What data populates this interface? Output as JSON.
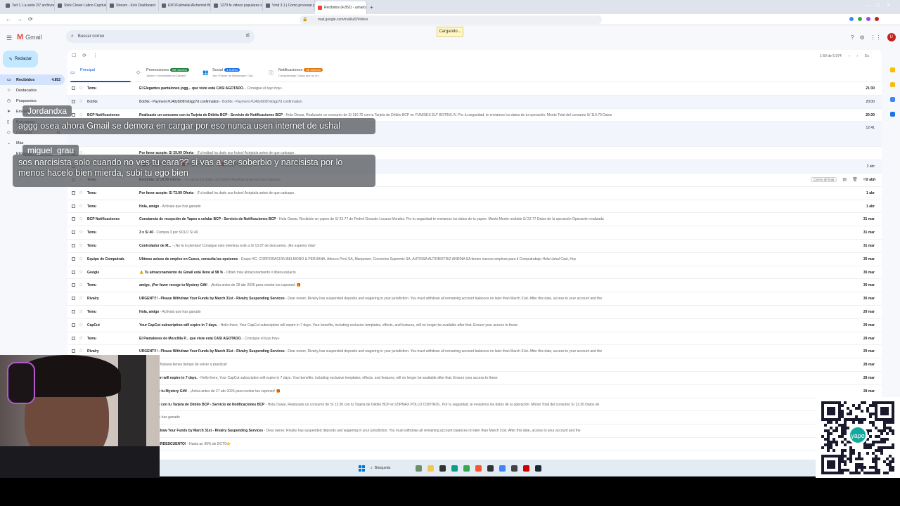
{
  "browser": {
    "tabs": [
      {
        "title": "Ted 1. La serie 2/7 archivos - HeliCrest"
      },
      {
        "title": "Stick Clover Latino Capítulo 160 - Yu"
      },
      {
        "title": "Stream - Kick Dashboard"
      },
      {
        "title": "ENT/Fullmetal Alchemist Brotherhood"
      },
      {
        "title": "1279 fe videos populares seleccion"
      },
      {
        "title": "Vmd 3.1 | Como procesar para pro"
      },
      {
        "title": "Recibidos (4.852) - ushalcast@g",
        "active": true
      }
    ],
    "new_tab": "+",
    "url": "mail.google.com/mail/u/0/#inbox",
    "loading_text": "Cargando..."
  },
  "gmail": {
    "app_name": "Gmail",
    "search_placeholder": "Buscar correo",
    "avatar_letter": "U",
    "compose_label": "Redactar",
    "sidebar": [
      {
        "label": "Recibidos",
        "count": "4.852",
        "icon": "inbox-icon",
        "active": true
      },
      {
        "label": "Destacados",
        "count": "",
        "icon": "star-icon"
      },
      {
        "label": "Pospuestos",
        "count": "",
        "icon": "clock-icon"
      },
      {
        "label": "Enviados",
        "count": "",
        "icon": "send-icon"
      },
      {
        "label": "Borradores",
        "count": "",
        "icon": "draft-icon"
      },
      {
        "label": "Compras",
        "count": "41",
        "icon": "tag-icon"
      },
      {
        "label": "Más",
        "count": "",
        "icon": "chevron-down-icon"
      },
      {
        "label": "Etiquetas",
        "count": "",
        "icon": ""
      }
    ],
    "pager": {
      "range": "1-50 de 5.074",
      "lang": "Es"
    },
    "category_tabs": [
      {
        "label": "Principal",
        "badge": "",
        "sub": "",
        "icon": "inbox-icon",
        "active": true
      },
      {
        "label": "Promociones",
        "badge": "50 nuevos",
        "badge_color": "#188038",
        "sub": "Jabeer • Novedades en Disney+",
        "icon": "tag-icon"
      },
      {
        "label": "Social",
        "badge": "1 nuevo",
        "badge_color": "#1a73e8",
        "sub": "Jee • Roses de Messenger: Cali...",
        "icon": "people-icon"
      },
      {
        "label": "Notificaciones",
        "badge": "35 nuevos",
        "badge_color": "#e37400",
        "sub": "Computrabajo: Datos que no en...",
        "icon": "info-icon"
      }
    ],
    "hover_pill": "Correo de hoja",
    "attachments": [
      {
        "name": "MVI_1453.MOV"
      },
      {
        "name": "MVI_1447.MOV"
      },
      {
        "name": "MVI_1455.MOV"
      }
    ],
    "emails": [
      {
        "sender": "Temu",
        "subject": "El Elegantes pantalones jogg... que viste está CASI AGOTADO.",
        "snippet": " - Consigue el tuyo hoy»",
        "date": "21:30",
        "read": false
      },
      {
        "sender": "BotiNx",
        "subject": "BotiNx - Payment #U40yt9087ebigp7d confirmation",
        "snippet": " - BotiNx - Payment #U40yt9087ebigp7d confirmation",
        "date": "20:00",
        "read": true
      },
      {
        "sender": "BCP Notificaciones",
        "subject": "Realizaste un consumo con tu Tarjeta de Débito BCP - Servicio de Notificaciones BCP",
        "snippet": " - Hola Oswar, Realizaste un consumo de S/ 110.70 con tu Tarjeta de Débito BCP en FUNGIES EU* BOTINX.IV. Por tu seguridad, te enviamos los datos de tu operación. Monto Total del consumo S/ 110.70 Datos",
        "date": "20:30",
        "read": false
      },
      {
        "sender": "",
        "subject": "",
        "snippet": "15:39 Subject: tus videos To: <ushalcast@gmail.com> MVI_1430...",
        "date": "12:41",
        "read": true,
        "tall": true
      },
      {
        "sender": "",
        "subject": "Por favor acepte: S/ 29.99 Oferta",
        "snippet": " - ¡Tu lealtad ha dado sus frutos! Acéptala antes de que caduque.",
        "date": "",
        "read": false
      },
      {
        "sender": "",
        "subject": "",
        "snippet": "",
        "date": "2 abr",
        "read": true
      },
      {
        "sender": "Temu",
        "subject": "Recibida: S/ 29.99 Oferta",
        "snippet": " - ¡Tu apoyo ha dado sus frutos! Acéptala antes de que caduque.",
        "date": "2 abr",
        "read": false
      },
      {
        "sender": "Temu",
        "subject": "Por favor acepte: S/ 73.99 Oferta",
        "snippet": " - ¡Tu lealtad ha dado sus frutos! Acéptala antes de que caduque.",
        "date": "1 abr",
        "read": false
      },
      {
        "sender": "Temu",
        "subject": "Hola, amigo",
        "snippet": " - Actívala que has ganado",
        "date": "1 abr",
        "read": false
      },
      {
        "sender": "BCP Notificaciones",
        "subject": "Constancia de recepción de Yapeo a celular BCP - Servicio de Notificaciones BCP",
        "snippet": " - Hola Oswar, Recibiste un yapeo de S/ 22.77 de Pedrel Gonzalo Lucana Morales. Por tu seguridad te enviamos los datos de tu yapeo. Monto Monto recibido S/ 22.77 Datos de la operación Operación realizada",
        "date": "31 mar",
        "read": false
      },
      {
        "sender": "Temu",
        "subject": "3 x S/ 40",
        "snippet": " - Compra 3 por SOLO S/ 40",
        "date": "31 mar",
        "read": false
      },
      {
        "sender": "Temu",
        "subject": "Controlador de M...",
        "snippet": " - ¡No te lo pierdas! Consigue esto mientras esté a S/ 13.07 de descuento. ¡No esperes más!",
        "date": "31 mar",
        "read": false
      },
      {
        "sender": "Equipo de Computrab.",
        "subject": "Últimos avisos de empleo en Cusco, consulta las opciones",
        "snippet": " - Grupo HC, CORPORACIÓN BELMONO & PERUANA, Adecco Perú SA, Manpower, Concretos Supermix SA, AUTRISA AUTOMOTRIZ ANDINA SA tienen nuevos empleos para ti Computrabajo Hola Ushal Cast, Hoy",
        "date": "30 mar",
        "read": false
      },
      {
        "sender": "Google",
        "subject": "⚠️ Tu almacenamiento de Gmail está lleno al 98 %",
        "snippet": " - Obtén más almacenamiento o libera espacio",
        "date": "30 mar",
        "read": false
      },
      {
        "sender": "Temu",
        "subject": "amigo, ¡Por favor recoge tu Mystery Gift!",
        "snippet": " - ¡Actúa antes de 29 abr 2026 para revelar tus cupones! 🎁",
        "date": "30 mar",
        "read": false
      },
      {
        "sender": "Rivalry",
        "subject": "URGENT!!! - Please Withdraw Your Funds by March 31st - Rivalry Suspending Services",
        "snippet": " - Dear owner, Rivalry has suspended deposits and wagering in your jurisdiction. You must withdraw all remaining account balances no later than March 31st. After this date, access to your account and the",
        "date": "30 mar",
        "read": false
      },
      {
        "sender": "Temu",
        "subject": "Hola, amigo",
        "snippet": " - Actívala que has ganado",
        "date": "29 mar",
        "read": false
      },
      {
        "sender": "CapCut",
        "subject": "Your CapCut subscription will expire in 7 days.",
        "snippet": " - Hello there, Your CapCut subscription will expire in 7 days. Your benefits, including exclusive templates, effects, and features, will no longer be available after that. Ensure your access to these",
        "date": "29 mar",
        "read": false
      },
      {
        "sender": "Temu",
        "subject": "El Pantalones de Mezclilla P... que viste está CASI AGOTADO.",
        "snippet": " - Consigue el tuyo hoy»",
        "date": "29 mar",
        "read": false
      },
      {
        "sender": "Rivalry",
        "subject": "URGENT!!! - Please Withdraw Your Funds by March 31st - Rivalry Suspending Services",
        "snippet": " - Dear owner, Rivalry has suspended deposits and wagering in your jurisdiction. You must withdraw all remaining account balances no later than March 31st. After this date, access to your account and the",
        "date": "29 mar",
        "read": false
      },
      {
        "sender": "Temu",
        "subject": "n 4 días...",
        "snippet": " - ¡Todavía tienes tiempo de volver a practicar!",
        "date": "28 mar",
        "read": false
      },
      {
        "sender": "CapCut",
        "subject": "t subscription will expire in 7 days.",
        "snippet": " - Hello there, Your CapCut subscription will expire in 7 days. Your benefits, including exclusive templates, effects, and features, will no longer be available after that. Ensure your access to these",
        "date": "28 mar",
        "read": false
      },
      {
        "sender": "Temu",
        "subject": "favor recoge tu Mystery Gift!",
        "snippet": " - ¡Actúa antes de 27 abr 2026 para revelar tus cupones! 🎁",
        "date": "28 mar",
        "read": false
      },
      {
        "sender": "BCP Notificaciones",
        "subject": "un consumo con tu Tarjeta de Débito BCP - Servicio de Notificaciones BCP",
        "snippet": " - Hola Oswar, Realizaste un consumo de S/ 12.30 con tu Tarjeta de Débito BCP en IZIPMAX POLLO CONTROL. Por tu seguridad, te enviamos los datos de tu operación. Monto Total del consumo S/ 12.30 Datos de",
        "date": "",
        "read": false
      },
      {
        "sender": "Temu",
        "subject": "",
        "snippet": " - Actívala que has ganado",
        "date": "",
        "read": false
      },
      {
        "sender": "Rivalry",
        "subject": "Please Withdraw Your Funds by March 31st - Rivalry Suspending Services",
        "snippet": " - Dear owner, Rivalry has suspended deposits and wagering in your jurisdiction. You must withdraw all remaining account balances no later than March 31st. After this date, access to your account and the",
        "date": "",
        "read": false
      },
      {
        "sender": "Temu",
        "subject": "TE UN SUPERDESCUENTO!",
        "snippet": " - Hasta un 90% de DCTO👉",
        "date": "",
        "read": false
      }
    ]
  },
  "taskbar": {
    "search_label": "Búsqueda"
  },
  "chat": [
    {
      "user": "Jordandxa",
      "message": "aggg osea ahora Gmail se demora en cargar por eso nunca usen internet de ushal"
    },
    {
      "user": "miguel_grau",
      "message": "sos narcisista solo cuando no ves tu cara?? si vas a ser soberbio y narcisista por lo menos hacelo bien mierda, subi tu ego bien"
    }
  ],
  "qr_label": "yape",
  "colors": {
    "accent": "#0b57d0",
    "gmail_red": "#ea4335",
    "selected_bg": "#d3e3fd"
  }
}
